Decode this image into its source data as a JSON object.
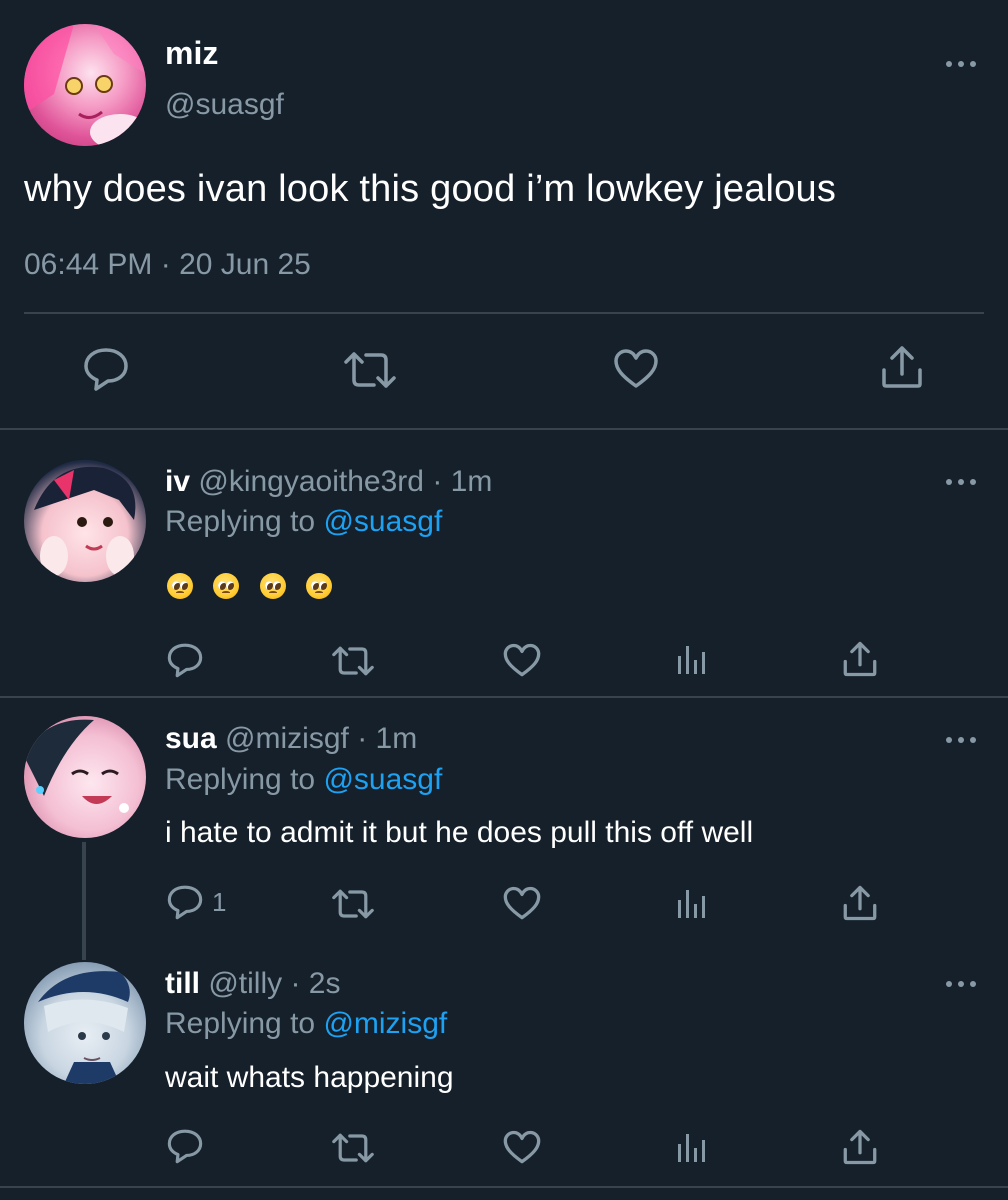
{
  "main_tweet": {
    "display_name": "miz",
    "handle": "@suasgf",
    "text": "why does ivan look this good i’m lowkey jealous",
    "timestamp": "06:44 PM · 20 Jun 25"
  },
  "replies": [
    {
      "display_name": "iv",
      "handle": "@kingyaoithe3rd",
      "time": "· 1m",
      "replying_prefix": "Replying to",
      "replying_to": "@suasgf",
      "text": "",
      "emoji_count": 4,
      "reply_count": ""
    },
    {
      "display_name": "sua",
      "handle": "@mizisgf",
      "time": "· 1m",
      "replying_prefix": "Replying to",
      "replying_to": "@suasgf",
      "text": "i hate to admit it but he does pull this off well",
      "reply_count": "1"
    },
    {
      "display_name": "till",
      "handle": "@tilly",
      "time": "· 2s",
      "replying_prefix": "Replying to",
      "replying_to": "@mizisgf",
      "text": "wait whats happening",
      "reply_count": ""
    }
  ],
  "colors": {
    "background": "#15202b",
    "muted": "#8899a6",
    "accent": "#1da1f2",
    "divider": "#38444d"
  }
}
